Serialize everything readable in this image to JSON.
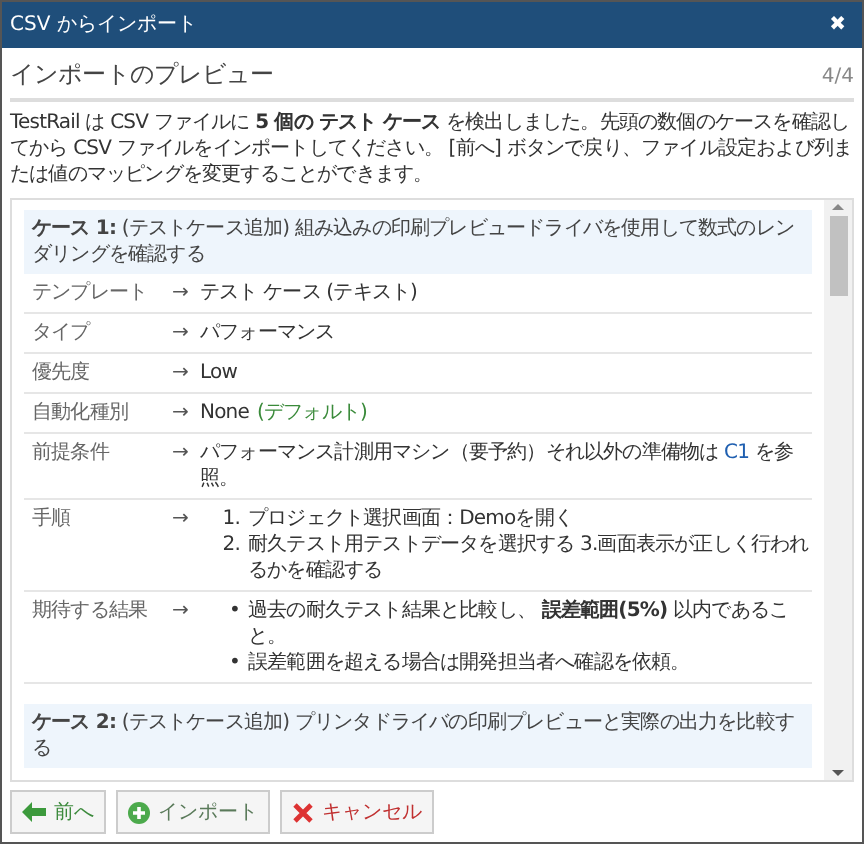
{
  "window": {
    "title": "CSV からインポート",
    "close": "✖"
  },
  "header": {
    "title": "インポートのプレビュー",
    "step": "4/4"
  },
  "intro": "TestRail は CSV ファイルに **5 個の テスト ケース** を検出しました。先頭の数個のケースを確認してから CSV ファイルをインポートしてください。 [前へ] ボタンで戻り、ファイル設定および列または値のマッピングを変更することができます。",
  "cases": [
    {
      "title": "**ケース 1:** (テストケース追加) 組み込みの印刷プレビュードライバを使用して数式のレンダリングを確認する",
      "fields": [
        {
          "label": "テンプレート",
          "arrow": "→",
          "kind": "text",
          "value": "テスト ケース (テキスト)"
        },
        {
          "label": "タイプ",
          "arrow": "→",
          "kind": "text",
          "value": "パフォーマンス"
        },
        {
          "label": "優先度",
          "arrow": "→",
          "kind": "text",
          "value": "Low"
        },
        {
          "label": "自動化種別",
          "arrow": "→",
          "kind": "default",
          "value": "None",
          "note": "(デフォルト)"
        },
        {
          "label": "前提条件",
          "arrow": "→",
          "kind": "link",
          "value": "パフォーマンス計測用マシン（要予約）それ以外の準備物は",
          "link": "C1",
          "after": "を参照。"
        },
        {
          "label": "手順",
          "arrow": "→",
          "kind": "ordered",
          "items": [
            {
              "num": "1.",
              "text": "プロジェクト選択画面：Demoを開く"
            },
            {
              "num": "2.",
              "text": "耐久テスト用テストデータを選択する 3.画面表示が正しく行われるかを確認する"
            }
          ]
        },
        {
          "label": "期待する結果",
          "arrow": "→",
          "kind": "bullets",
          "items": [
            {
              "bullet": "•",
              "text": "過去の耐久テスト結果と比較し、 **誤差範囲(5%)** 以内であること。"
            },
            {
              "bullet": "•",
              "text": "誤差範囲を超える場合は開発担当者へ確認を依頼。"
            }
          ]
        }
      ]
    },
    {
      "title": "**ケース 2:** (テストケース追加) プリンタドライバの印刷プレビューと実際の出力を比較する"
    }
  ],
  "buttons": [
    {
      "kind": "back",
      "label": "前へ"
    },
    {
      "kind": "import",
      "label": "インポート"
    },
    {
      "kind": "cancel",
      "label": "キャンセル"
    }
  ]
}
